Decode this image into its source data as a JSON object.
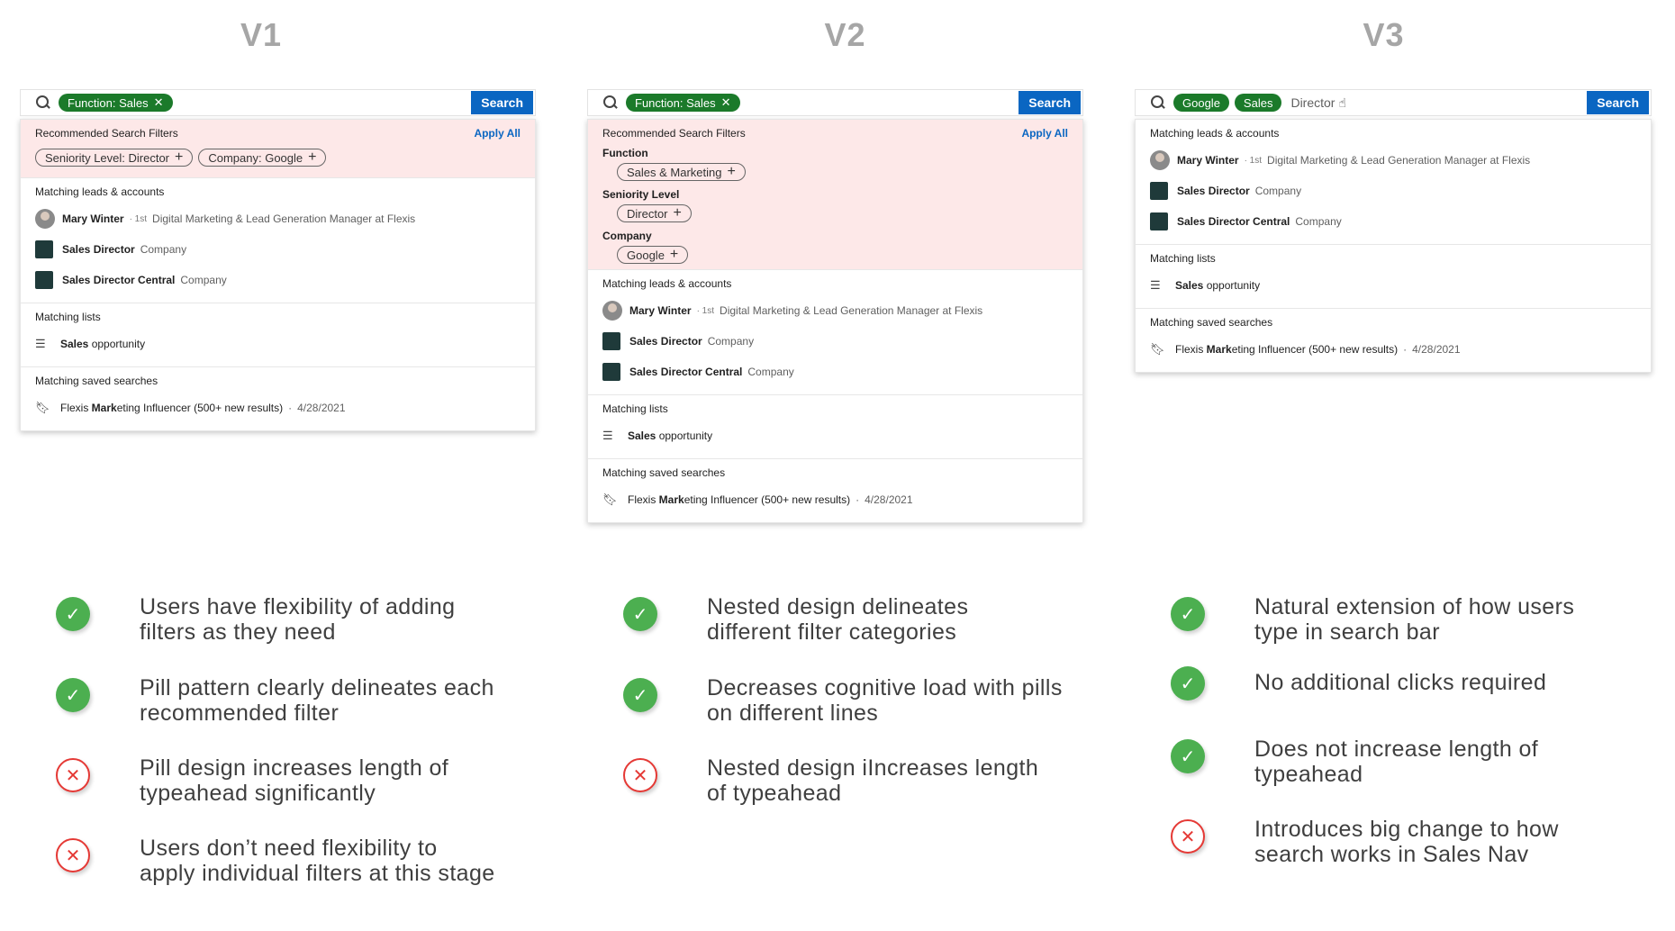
{
  "v1": {
    "title": "V1",
    "search": {
      "pill": "Function: Sales",
      "button": "Search"
    },
    "reco": {
      "title": "Recommended Search Filters",
      "apply_all": "Apply All",
      "pills": [
        "Seniority Level: Director",
        "Company: Google"
      ]
    },
    "leads": {
      "title": "Matching leads & accounts",
      "person": {
        "name": "Mary Winter",
        "degree": "· 1st",
        "headline": "Digital Marketing & Lead Generation Manager at Flexis"
      },
      "companies": [
        {
          "name": "Sales Director",
          "type": "Company"
        },
        {
          "name": "Sales Director Central",
          "type": "Company"
        }
      ]
    },
    "lists": {
      "title": "Matching lists",
      "item_bold": "Sales",
      "item_rest": " opportunity"
    },
    "saved": {
      "title": "Matching saved searches",
      "pre": "Flexis ",
      "bold": "Mark",
      "post": "eting Influencer (500+ new results)",
      "date": "4/28/2021"
    },
    "evals": [
      {
        "type": "pro",
        "text1": "Users have flexibility of adding",
        "text2": "filters as they need"
      },
      {
        "type": "pro",
        "text1": "Pill pattern clearly delineates each",
        "text2": "recommended filter"
      },
      {
        "type": "con",
        "text1": "Pill design increases length of",
        "text2": "typeahead significantly"
      },
      {
        "type": "con",
        "text1": "Users don’t need flexibility to",
        "text2": "apply individual filters at this stage"
      }
    ]
  },
  "v2": {
    "title": "V2",
    "search": {
      "pill": "Function: Sales",
      "button": "Search"
    },
    "reco": {
      "title": "Recommended Search Filters",
      "apply_all": "Apply All",
      "groups": [
        {
          "label": "Function",
          "pill": "Sales & Marketing"
        },
        {
          "label": "Seniority Level",
          "pill": "Director"
        },
        {
          "label": "Company",
          "pill": "Google"
        }
      ]
    },
    "leads": {
      "title": "Matching leads & accounts",
      "person": {
        "name": "Mary Winter",
        "degree": "· 1st",
        "headline": "Digital Marketing & Lead Generation Manager at Flexis"
      },
      "companies": [
        {
          "name": "Sales Director",
          "type": "Company"
        },
        {
          "name": "Sales Director Central",
          "type": "Company"
        }
      ]
    },
    "lists": {
      "title": "Matching lists",
      "item_bold": "Sales",
      "item_rest": " opportunity"
    },
    "saved": {
      "title": "Matching saved searches",
      "pre": "Flexis ",
      "bold": "Mark",
      "post": "eting Influencer (500+ new results)",
      "date": "4/28/2021"
    },
    "evals": [
      {
        "type": "pro",
        "text1": "Nested design delineates",
        "text2": "different filter categories"
      },
      {
        "type": "pro",
        "text1": "Decreases cognitive load with pills",
        "text2": "on different lines"
      },
      {
        "type": "con",
        "text1": "Nested design iIncreases length",
        "text2": "of typeahead"
      }
    ]
  },
  "v3": {
    "title": "V3",
    "search": {
      "pills": [
        "Google",
        "Sales"
      ],
      "typed": "Director",
      "button": "Search"
    },
    "leads": {
      "title": "Matching leads & accounts",
      "person": {
        "name": "Mary Winter",
        "degree": "· 1st",
        "headline": "Digital Marketing & Lead Generation Manager at Flexis"
      },
      "companies": [
        {
          "name": "Sales Director",
          "type": "Company"
        },
        {
          "name": "Sales Director Central",
          "type": "Company"
        }
      ]
    },
    "lists": {
      "title": "Matching lists",
      "item_bold": "Sales",
      "item_rest": " opportunity"
    },
    "saved": {
      "title": "Matching saved searches",
      "pre": "Flexis ",
      "bold": "Mark",
      "post": "eting Influencer (500+ new results)",
      "date": "4/28/2021"
    },
    "evals": [
      {
        "type": "pro",
        "text1": "Natural extension of how users",
        "text2": "type in search bar"
      },
      {
        "type": "pro",
        "text1": "No additional clicks required",
        "text2": ""
      },
      {
        "type": "pro",
        "text1": "Does not increase length of",
        "text2": "typeahead"
      },
      {
        "type": "con",
        "text1": "Introduces big change to how",
        "text2": "search works in Sales Nav"
      }
    ]
  },
  "icons": {
    "check": "check-icon",
    "cross": "cross-icon",
    "search": "search-icon",
    "list": "list-icon",
    "bookmark": "bookmark-icon",
    "cursor": "hand-cursor-icon"
  },
  "colors": {
    "brand_blue": "#0a66c2",
    "pill_green": "#1b7a2a",
    "reco_bg": "#fde8e8",
    "pro_green": "#4caf50",
    "con_red": "#e53935",
    "title_gray": "#a6a6a6"
  }
}
